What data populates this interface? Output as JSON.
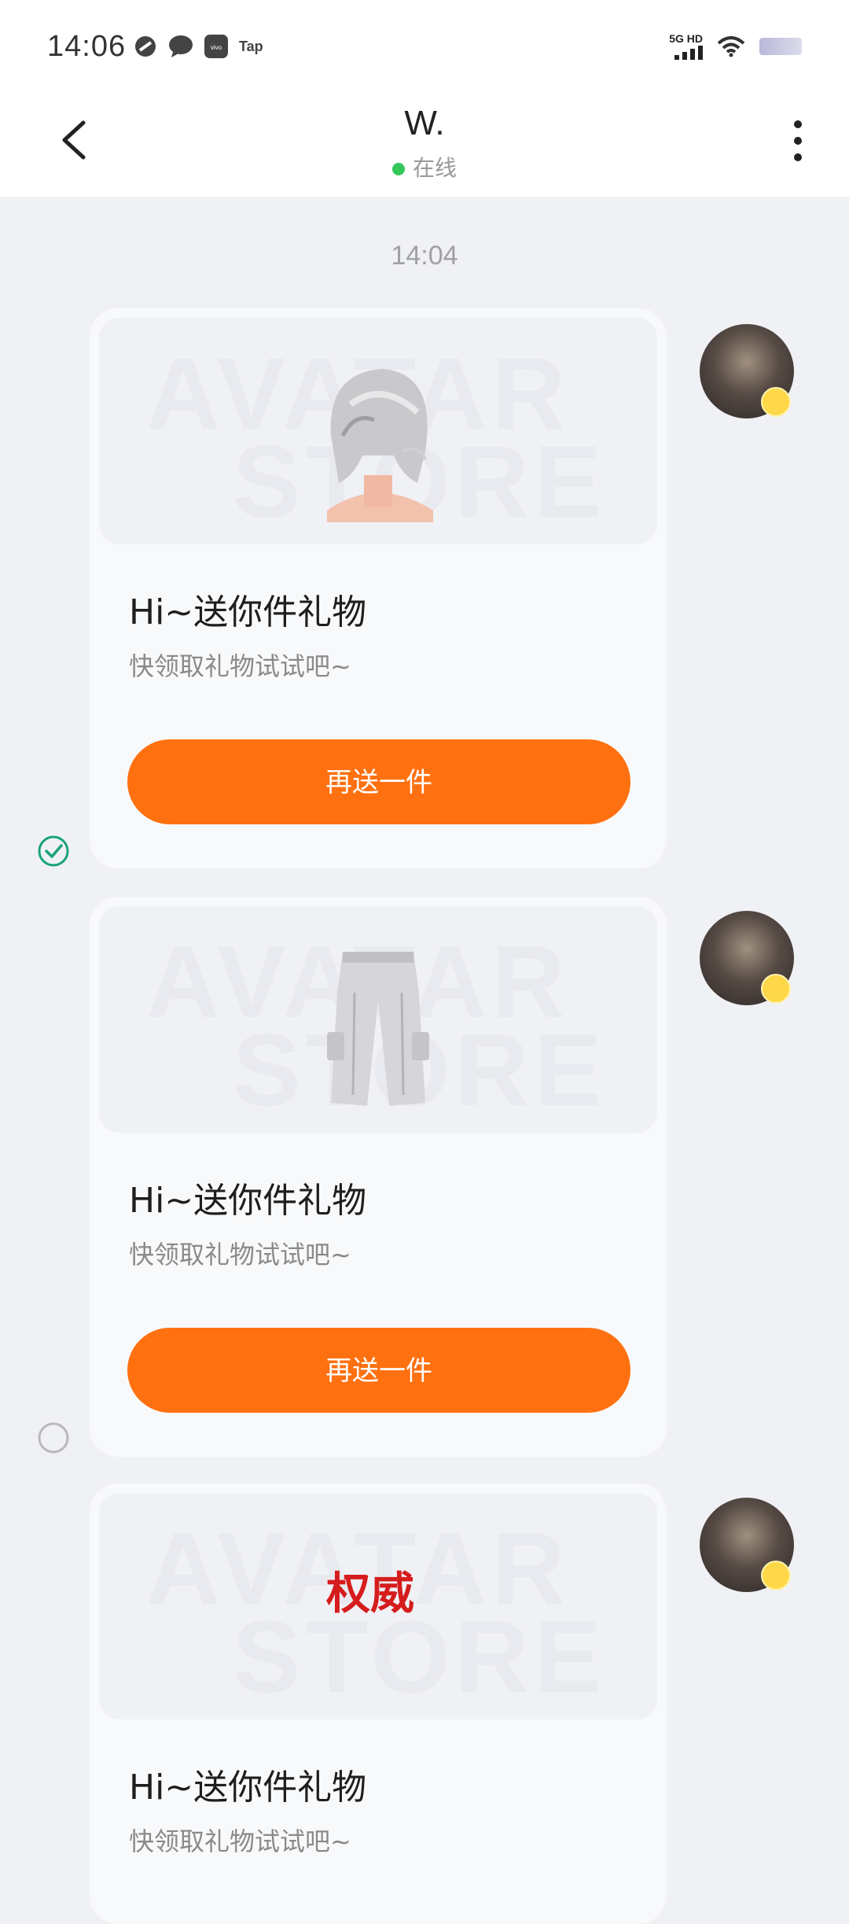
{
  "status_bar": {
    "time": "14:06",
    "left_icons": [
      "link-icon",
      "chat-bubble-icon",
      "vivo-icon"
    ],
    "tap_label": "Tap",
    "network_label": "5G HD",
    "right_icons": [
      "signal-icon",
      "wifi-icon",
      "battery-icon"
    ]
  },
  "header": {
    "title": "W.",
    "status": "在线",
    "back_icon": "chevron-left-icon",
    "more_icon": "more-vertical-icon"
  },
  "chat": {
    "timestamp": "14:04",
    "messages": [
      {
        "item": "hair",
        "watermark_line1": "AVATAR",
        "watermark_line2": "STORE",
        "title": "Hi~送你件礼物",
        "subtitle": "快领取礼物试试吧~",
        "button": "再送一件",
        "selected": true
      },
      {
        "item": "pants",
        "watermark_line1": "AVATAR",
        "watermark_line2": "STORE",
        "title": "Hi~送你件礼物",
        "subtitle": "快领取礼物试试吧~",
        "button": "再送一件",
        "selected": false
      },
      {
        "item": "calligraphy",
        "item_text": "权威",
        "watermark_line1": "AVATAR",
        "watermark_line2": "STORE",
        "title": "Hi~送你件礼物",
        "subtitle": "快领取礼物试试吧~"
      }
    ]
  },
  "colors": {
    "accent": "#ff7110",
    "online": "#34c759",
    "check": "#1aa37a",
    "background": "#f0f1f5"
  }
}
